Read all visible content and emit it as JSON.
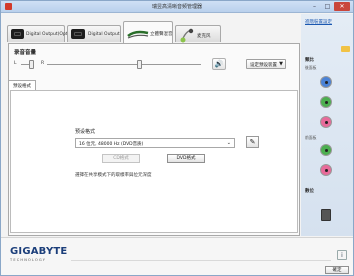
{
  "window": {
    "title": "瑞昱高清晰音频管理器",
    "minimize_label": "–",
    "maximize_label": "□",
    "close_label": "✕"
  },
  "tabs": [
    {
      "label": "Digital Output(Optical)"
    },
    {
      "label": "Digital Output"
    },
    {
      "label": "立體聲混音"
    },
    {
      "label": "麦克风"
    }
  ],
  "volume": {
    "title": "录音音量",
    "left_label": "L",
    "right_label": "R",
    "speaker_icon": "speaker-icon",
    "default_device_label": "设定预设装置"
  },
  "inner_tab": {
    "label": "预设格式"
  },
  "format": {
    "label": "预设格式",
    "selected": "16 位元, 48000 Hz (DVD音质)",
    "edit_icon": "edit-icon",
    "cd_button": "CD格式",
    "dvd_button": "DVD格式",
    "hint": "選擇在共享模式下的取樣率與位元深度"
  },
  "right_panel": {
    "advanced_link": "進階裝置設定",
    "analog_title": "類比",
    "rear_panel": "後面板",
    "front_panel": "前面板",
    "digital_title": "數位",
    "rear_jacks": [
      {
        "color": "#4a82d6"
      },
      {
        "color": "#4caf50"
      },
      {
        "color": "#e86a9a"
      }
    ],
    "front_jacks": [
      {
        "color": "#4caf50"
      },
      {
        "color": "#e86a9a"
      }
    ]
  },
  "footer": {
    "brand": "GIGABYTE",
    "brand_sub": "TECHNOLOGY",
    "info_label": "i",
    "ok_label": "確定"
  }
}
